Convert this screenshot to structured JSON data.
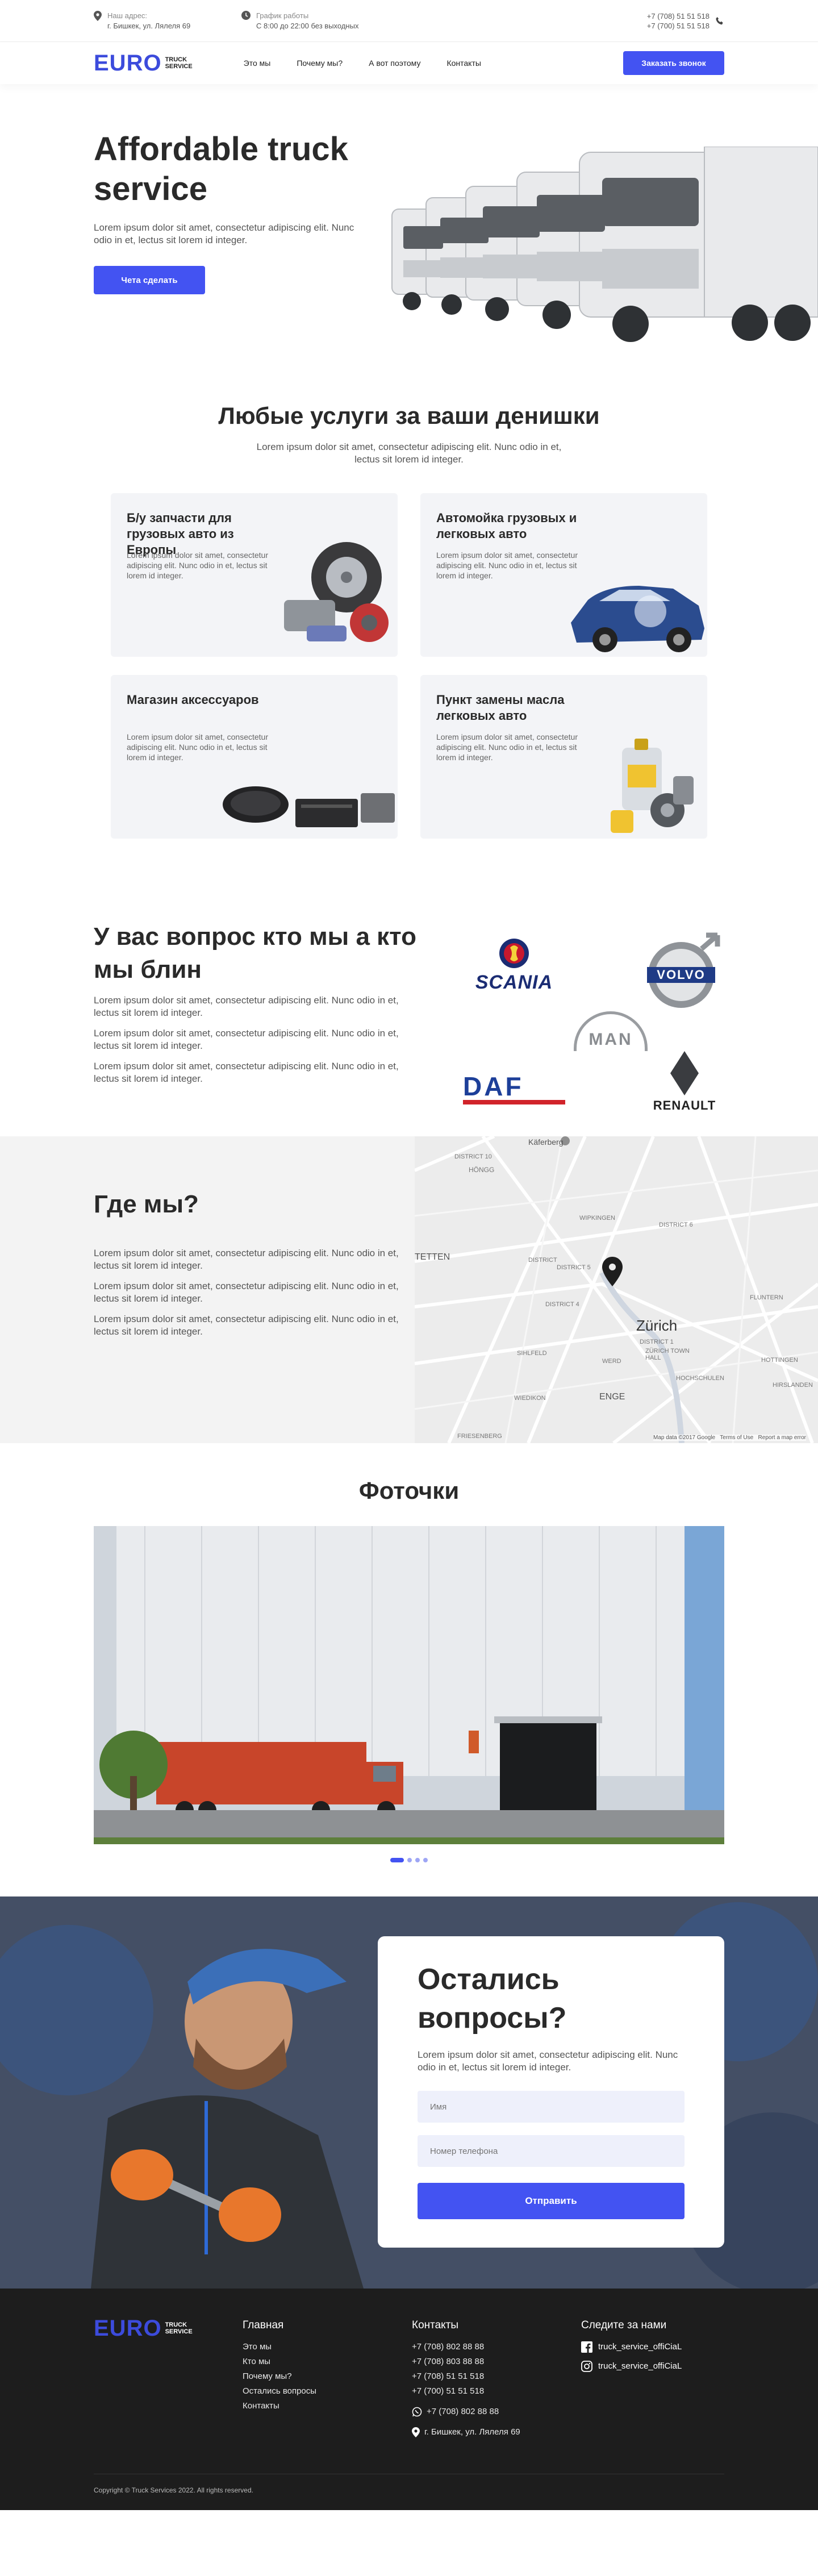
{
  "topbar": {
    "address_label": "Наш адрес:",
    "address": "г. Бишкек, ул. Лялеля 69",
    "schedule_label": "График работы",
    "schedule": "С 8:00 до 22:00 без выходных",
    "phone1": "+7 (708) 51 51 518",
    "phone2": "+7 (700) 51 51 518"
  },
  "logo": {
    "euro": "EURO",
    "line1": "TRUCK",
    "line2": "SERVICE"
  },
  "nav": {
    "items": [
      "Это мы",
      "Почему мы?",
      "А вот поэтому",
      "Контакты"
    ],
    "cta": "Заказать звонок"
  },
  "hero": {
    "title": "Affordable truck service",
    "text": "Lorem ipsum dolor sit amet, consectetur adipiscing elit. Nunc odio in et, lectus sit lorem id integer.",
    "button": "Чета сделать"
  },
  "services": {
    "title": "Любые услуги за ваши денишки",
    "subtitle": "Lorem ipsum dolor sit amet, consectetur adipiscing elit. Nunc odio in et, lectus sit lorem id integer.",
    "cards": [
      {
        "title": "Б/у запчасти для грузовых авто из Европы",
        "text": "Lorem ipsum dolor sit amet, consectetur adipiscing elit. Nunc odio in et, lectus sit lorem id integer."
      },
      {
        "title": "Автомойка грузовых и легковых авто",
        "text": "Lorem ipsum dolor sit amet, consectetur adipiscing elit. Nunc odio in et, lectus sit lorem id integer."
      },
      {
        "title": "Магазин аксессуаров",
        "text": "Lorem ipsum dolor sit amet, consectetur adipiscing elit. Nunc odio in et, lectus sit lorem id integer."
      },
      {
        "title": "Пункт замены масла легковых авто",
        "text": "Lorem ipsum dolor sit amet, consectetur adipiscing elit. Nunc odio in et, lectus sit lorem id integer."
      }
    ]
  },
  "about": {
    "title": "У вас вопрос кто мы а кто мы блин",
    "paragraphs": [
      "Lorem ipsum dolor sit amet, consectetur adipiscing elit. Nunc odio in et, lectus sit lorem id integer.",
      "Lorem ipsum dolor sit amet, consectetur adipiscing elit. Nunc odio in et, lectus sit lorem id integer.",
      "Lorem ipsum dolor sit amet, consectetur adipiscing elit. Nunc odio in et, lectus sit lorem id integer."
    ],
    "brands": [
      "SCANIA",
      "VOLVO",
      "MAN",
      "DAF",
      "RENAULT"
    ]
  },
  "where": {
    "title": "Где мы?",
    "paragraphs": [
      "Lorem ipsum dolor sit amet, consectetur adipiscing elit. Nunc odio in et, lectus sit lorem id integer.",
      "Lorem ipsum dolor sit amet, consectetur adipiscing elit. Nunc odio in et, lectus sit lorem id integer.",
      "Lorem ipsum dolor sit amet, consectetur adipiscing elit. Nunc odio in et, lectus sit lorem id integer."
    ],
    "map": {
      "labels": [
        "Käferberg",
        "HÖNGG",
        "DISTRICT 10",
        "WIPKINGEN",
        "DISTRICT 6",
        "DISTRICT 5",
        "DISTRICT",
        "DISTRICT 4",
        "Zürich",
        "DISTRICT 1",
        "ZÜRICH TOWN HALL",
        "FLUNTERN",
        "HOTTINGEN",
        "HOCHSCHULEN",
        "SIHLFELD",
        "WERD",
        "WIEDIKON",
        "ENGE",
        "FRIESENBERG",
        "HIRSLANDEN",
        "TETTEN"
      ],
      "attribution": "Map data ©2017 Google",
      "terms": "Terms of Use",
      "report": "Report a map error"
    }
  },
  "photos": {
    "title": "Фоточки",
    "slides": 4,
    "active": 1
  },
  "contact": {
    "title": "Остались вопросы?",
    "text": "Lorem ipsum dolor sit amet, consectetur adipiscing elit. Nunc odio in et, lectus sit lorem id integer.",
    "name_placeholder": "Имя",
    "phone_placeholder": "Номер телефона",
    "submit": "Отправить"
  },
  "footer": {
    "nav_title": "Главная",
    "nav_items": [
      "Это мы",
      "Кто мы",
      "Почему мы?",
      "Остались вопросы",
      "Контакты"
    ],
    "contacts_title": "Контакты",
    "phones": [
      "+7 (708) 802 88 88",
      "+7 (708) 803 88 88",
      "+7 (708) 51 51 518",
      "+7 (700) 51 51 518"
    ],
    "whatsapp": "+7 (708) 802 88 88",
    "address": "г. Бишкек, ул. Лялеля 69",
    "social_title": "Следите за нами",
    "facebook": "truck_service_offiCiaL",
    "instagram": "truck_service_offiCiaL",
    "copyright": "Copyright © Truck Services 2022. All rights reserved."
  },
  "colors": {
    "accent": "#4353f2",
    "dark": "#1d1d1d",
    "card": "#f3f4f7"
  }
}
